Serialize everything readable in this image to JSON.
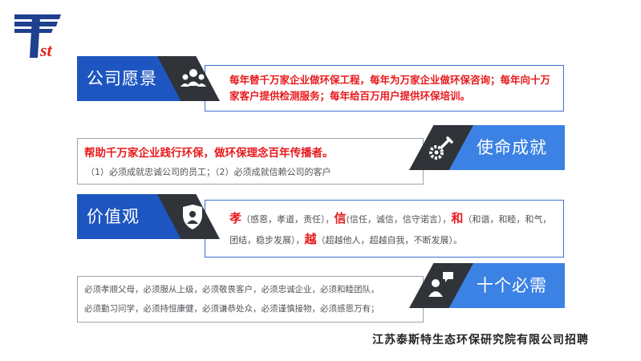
{
  "logo": {
    "text": "st"
  },
  "sections": {
    "vision": {
      "title": "公司愿景",
      "text": "每年替千万家企业做环保工程，每年为万家企业做环保咨询；每年向十万家客户提供检测服务；每年给百万用户提供环保培训。",
      "icon": "team-icon"
    },
    "mission": {
      "title": "使命成就",
      "headline": "帮助千万家企业践行环保，做环保理念百年传播者。",
      "subtext": "（1）必须成就忠诚公司的员工；（2）必须成就信赖公司的客户",
      "icon": "gear-wrench-icon"
    },
    "values": {
      "title": "价值观",
      "icon": "shield-user-icon",
      "items": [
        {
          "key": "孝",
          "desc": "（感恩，孝道，责任），"
        },
        {
          "key": "信",
          "desc": "(信任，诚信，信守诺言），"
        },
        {
          "key": "和",
          "desc": "（和谐，和睦，和气，团结，稳步发展），"
        },
        {
          "key": "越",
          "desc": "（超越他人，超越自我，不断发展）。"
        }
      ]
    },
    "musts": {
      "title": "十个必需",
      "icon": "speech-person-icon",
      "line1": "必须孝顺父母，必须服从上级，必须敬畏客户，必须忠诚企业，必须和睦团队，",
      "line2": "必须勤习问学，必须持恒康健，必须谦恭处众，必须谨慎接物，必须感恩万有；"
    }
  },
  "footer": {
    "text": "江苏泰斯特生态环保研究院有限公司招聘"
  }
}
